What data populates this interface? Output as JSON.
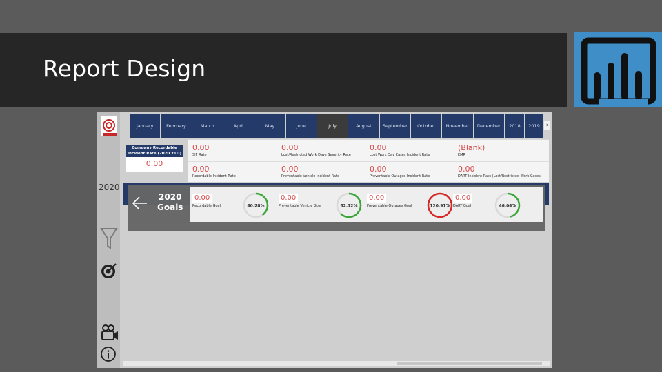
{
  "slide": {
    "title": "Report Design"
  },
  "report": {
    "months": [
      "January",
      "February",
      "March",
      "April",
      "May",
      "June",
      "July",
      "August",
      "September",
      "October",
      "November",
      "December"
    ],
    "active_month": "July",
    "years": [
      "2018",
      "2019"
    ],
    "rail": {
      "year": "2020",
      "logo_text": "NEEDS"
    },
    "left_kpi": {
      "label": "Company Recordable Incident Rate (2020 YTD)",
      "value": "0.00"
    },
    "kpis_row1": [
      {
        "value": "0.00",
        "label": "SIF Rate"
      },
      {
        "value": "0.00",
        "label": "Lost/Restricted Work Days Severity Rate"
      },
      {
        "value": "0.00",
        "label": "Lost Work Day Cases Incident Rate"
      },
      {
        "value": "(Blank)",
        "label": "EMR"
      }
    ],
    "kpis_row2": [
      {
        "value": "0.00",
        "label": "Recordable Incident Rate"
      },
      {
        "value": "0.00",
        "label": "Preventable Vehicle Incident Rate"
      },
      {
        "value": "0.00",
        "label": "Preventable Outages Incident Rate"
      },
      {
        "value": "0.00",
        "label": "DART Incident Rate (Lost/Restricted Work Cases)"
      }
    ],
    "goals": {
      "year": "2020",
      "title": "Goals",
      "items": [
        {
          "value": "0.00",
          "label": "Recordable Goal",
          "percent_text": "40.28%",
          "percent": 40.28,
          "color": "#3aa63a"
        },
        {
          "value": "0.00",
          "label": "Preventable Vehicle Goal",
          "percent_text": "62.12%",
          "percent": 62.12,
          "color": "#3aa63a"
        },
        {
          "value": "0.00",
          "label": "Preventable Outages Goal",
          "percent_text": "120.91%",
          "percent": 100,
          "color": "#d62828"
        },
        {
          "value": "0.00",
          "label": "DART Goal",
          "percent_text": "46.04%",
          "percent": 46.04,
          "color": "#3aa63a"
        }
      ]
    },
    "colors": {
      "navy": "#243b6a",
      "kpi_red": "#d64a4a",
      "pbi_blue": "#3f8ec8"
    }
  }
}
